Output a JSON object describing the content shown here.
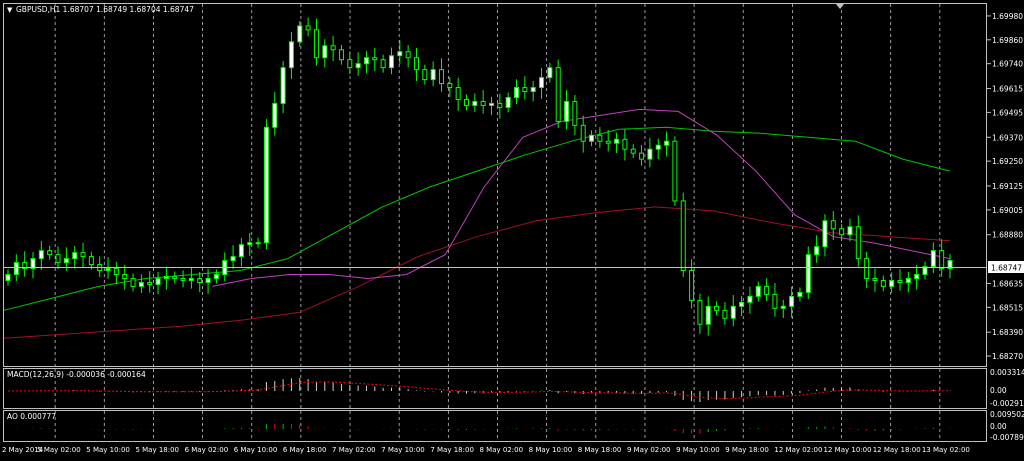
{
  "main": {
    "title": "GBPUSD,H1  1.68707 1.68749 1.68704 1.68747",
    "y_labels": [
      "1.69980",
      "1.69860",
      "1.69740",
      "1.69615",
      "1.69495",
      "1.69370",
      "1.69250",
      "1.69125",
      "1.69005",
      "1.68880",
      "1.68635",
      "1.68515",
      "1.68390",
      "1.68270"
    ],
    "current_price": "1.68747"
  },
  "macd": {
    "title": "MACD(12,26,9) -0.000036 -0.000164",
    "labels": [
      "0.003314",
      "0.00",
      "-0.00291"
    ]
  },
  "ao": {
    "title": "AO 0.000777",
    "labels": [
      "0.009502",
      "0.00",
      "-0.00789"
    ]
  },
  "time_axis": [
    "2 May 2014",
    "5 May 02:00",
    "5 May 10:00",
    "5 May 18:00",
    "6 May 02:00",
    "6 May 10:00",
    "6 May 18:00",
    "7 May 02:00",
    "7 May 10:00",
    "7 May 18:00",
    "8 May 02:00",
    "8 May 10:00",
    "8 May 18:00",
    "9 May 02:00",
    "9 May 10:00",
    "9 May 18:00",
    "12 May 02:00",
    "12 May 10:00",
    "12 May 18:00",
    "13 May 02:00"
  ],
  "chart_data": {
    "type": "candlestick",
    "symbol": "GBPUSD",
    "timeframe": "H1",
    "ohlc_header": {
      "open": 1.68707,
      "high": 1.68749,
      "low": 1.68704,
      "close": 1.68747
    },
    "ylim": [
      1.6822,
      1.7004
    ],
    "close": [
      1.6868,
      1.6874,
      1.6871,
      1.6876,
      1.688,
      1.6878,
      1.6874,
      1.6876,
      1.6879,
      1.6877,
      1.6873,
      1.687,
      1.6871,
      1.6868,
      1.6866,
      1.6862,
      1.6864,
      1.6863,
      1.6866,
      1.6867,
      1.6866,
      1.6865,
      1.6866,
      1.6864,
      1.6866,
      1.6868,
      1.6875,
      1.6877,
      1.6883,
      1.6884,
      1.6884,
      1.6942,
      1.6954,
      1.6972,
      1.6985,
      1.6993,
      1.6991,
      1.6977,
      1.6983,
      1.6981,
      1.6976,
      1.6972,
      1.6974,
      1.6977,
      1.6976,
      1.6972,
      1.6978,
      1.698,
      1.6977,
      1.6971,
      1.6966,
      1.6971,
      1.6964,
      1.6962,
      1.6956,
      1.6953,
      1.6955,
      1.6953,
      1.6954,
      1.6952,
      1.6957,
      1.6962,
      1.696,
      1.6962,
      1.6967,
      1.6972,
      1.6945,
      1.6955,
      1.6943,
      1.6935,
      1.6938,
      1.6935,
      1.6934,
      1.6936,
      1.6931,
      1.6929,
      1.6926,
      1.6931,
      1.6933,
      1.6935,
      1.6905,
      1.687,
      1.6855,
      1.6843,
      1.6852,
      1.685,
      1.6846,
      1.6852,
      1.6854,
      1.6857,
      1.6862,
      1.6858,
      1.6851,
      1.6852,
      1.6857,
      1.6859,
      1.6878,
      1.6882,
      1.6895,
      1.6891,
      1.6888,
      1.6892,
      1.6876,
      1.6866,
      1.6865,
      1.6862,
      1.6865,
      1.6864,
      1.6866,
      1.6868,
      1.6872,
      1.688,
      1.6871,
      1.6875
    ],
    "ma_green": {
      "name": "MA (green)",
      "values_sampled": [
        1.685,
        1.6856,
        1.6862,
        1.6866,
        1.6868,
        1.687,
        1.6876,
        1.6889,
        1.6902,
        1.6912,
        1.692,
        1.6928,
        1.6935,
        1.6941,
        1.6942,
        1.694,
        1.6939,
        1.6937,
        1.6935,
        1.6926,
        1.692
      ]
    },
    "ma_purple": {
      "name": "MA (purple)",
      "values_sampled": [
        1.6862,
        1.6866,
        1.6868,
        1.6868,
        1.6866,
        1.6868,
        1.6878,
        1.6912,
        1.6937,
        1.6945,
        1.6948,
        1.6951,
        1.695,
        1.6938,
        1.692,
        1.6898,
        1.6887,
        1.6884,
        1.688,
        1.6876
      ]
    },
    "ma_darkred": {
      "name": "MA (dark red)",
      "values_sampled": [
        1.6836,
        1.6838,
        1.684,
        1.6842,
        1.6845,
        1.6849,
        1.6862,
        1.6877,
        1.6887,
        1.6895,
        1.6899,
        1.6902,
        1.69,
        1.6894,
        1.6889,
        1.6887,
        1.6885
      ]
    }
  },
  "colors": {
    "bg": "#000000",
    "bull": "#ffffff",
    "bear": "#000000",
    "wick": "#00ff00",
    "grid": "#c0c0c0",
    "ma_green": "#00c800",
    "ma_purple": "#c040c0",
    "ma_darkred": "#a01020",
    "signal": "#ff0000"
  }
}
